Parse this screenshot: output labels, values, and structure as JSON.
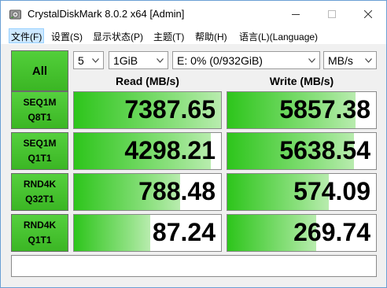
{
  "window": {
    "title": "CrystalDiskMark 8.0.2 x64 [Admin]"
  },
  "menu": [
    {
      "label": "文件(F)",
      "active": true
    },
    {
      "label": "设置(S)"
    },
    {
      "label": "显示状态(P)"
    },
    {
      "label": "主题(T)"
    },
    {
      "label": "帮助(H)"
    },
    {
      "label": "语言(L)(Language)"
    }
  ],
  "controls": {
    "all_label": "All",
    "count": "5",
    "size": "1GiB",
    "drive": "E: 0% (0/932GiB)",
    "unit": "MB/s"
  },
  "headers": {
    "read": "Read (MB/s)",
    "write": "Write (MB/s)"
  },
  "rows": [
    {
      "line1": "SEQ1M",
      "line2": "Q8T1",
      "read": "7387.65",
      "write": "5857.38",
      "read_fill": 1.0,
      "write_fill": 0.86
    },
    {
      "line1": "SEQ1M",
      "line2": "Q1T1",
      "read": "4298.21",
      "write": "5638.54",
      "read_fill": 0.93,
      "write_fill": 0.85
    },
    {
      "line1": "RND4K",
      "line2": "Q32T1",
      "read": "788.48",
      "write": "574.09",
      "read_fill": 0.72,
      "write_fill": 0.68
    },
    {
      "line1": "RND4K",
      "line2": "Q1T1",
      "read": "87.24",
      "write": "269.74",
      "read_fill": 0.52,
      "write_fill": 0.6
    }
  ],
  "status": ""
}
